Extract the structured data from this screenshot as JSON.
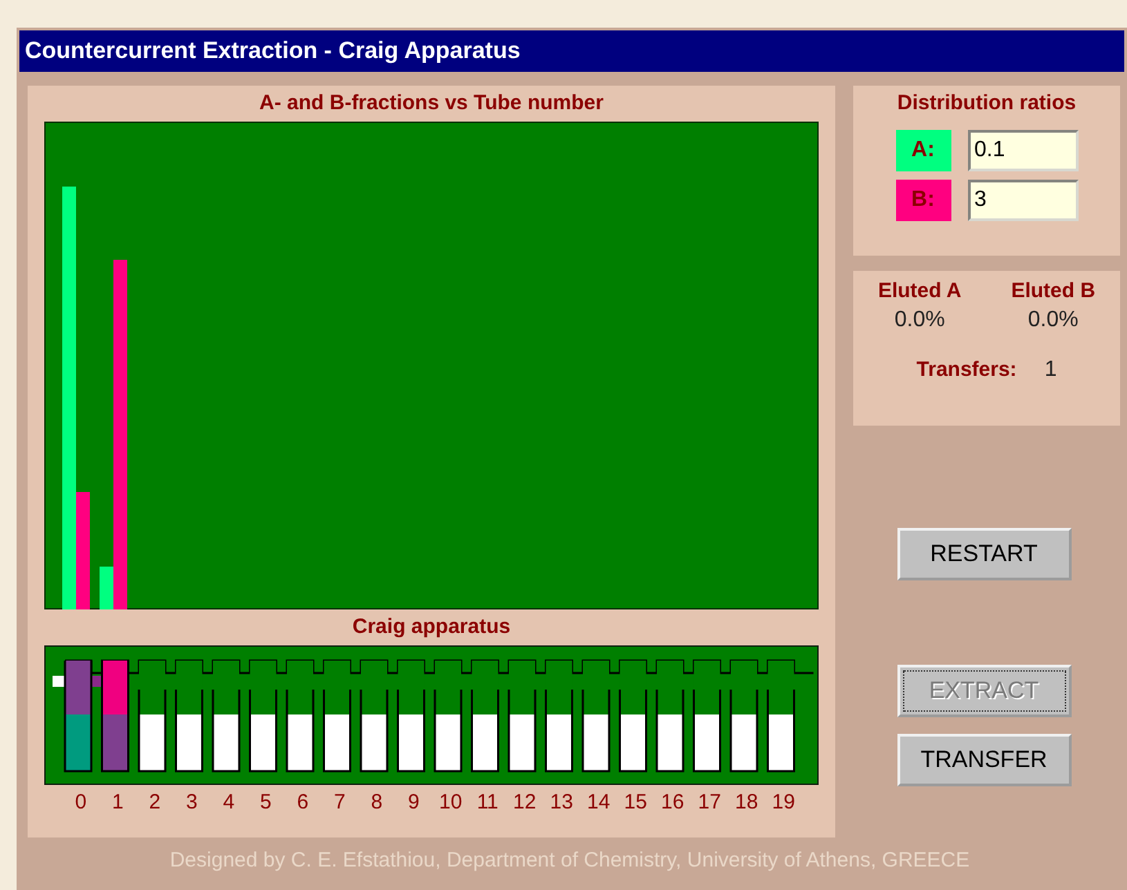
{
  "window": {
    "title": "Countercurrent Extraction - Craig Apparatus"
  },
  "graph": {
    "title": "A- and B-fractions vs Tube number"
  },
  "distribution": {
    "title": "Distribution ratios",
    "ratios": [
      {
        "label": "A:",
        "value": "0.1",
        "color": "#00ff80"
      },
      {
        "label": "B:",
        "value": "3",
        "color": "#ff0080"
      }
    ]
  },
  "eluted": {
    "columns": [
      {
        "label": "Eluted A",
        "value": "0.0%"
      },
      {
        "label": "Eluted B",
        "value": "0.0%"
      }
    ],
    "transfers": {
      "label": "Transfers:",
      "value": "1"
    }
  },
  "buttons": [
    {
      "label": "RESTART",
      "disabled": false
    },
    {
      "label": "EXTRACT",
      "disabled": true
    },
    {
      "label": "TRANSFER",
      "disabled": false
    }
  ],
  "apparatus": {
    "title": "Craig apparatus",
    "tubes": [
      "0",
      "1",
      "2",
      "3",
      "4",
      "5",
      "6",
      "7",
      "8",
      "9",
      "10",
      "11",
      "12",
      "13",
      "14",
      "15",
      "16",
      "17",
      "18",
      "19"
    ]
  },
  "footer": "Designed by C. E. Efstathiou, Department of Chemistry, University of Athens, GREECE"
}
